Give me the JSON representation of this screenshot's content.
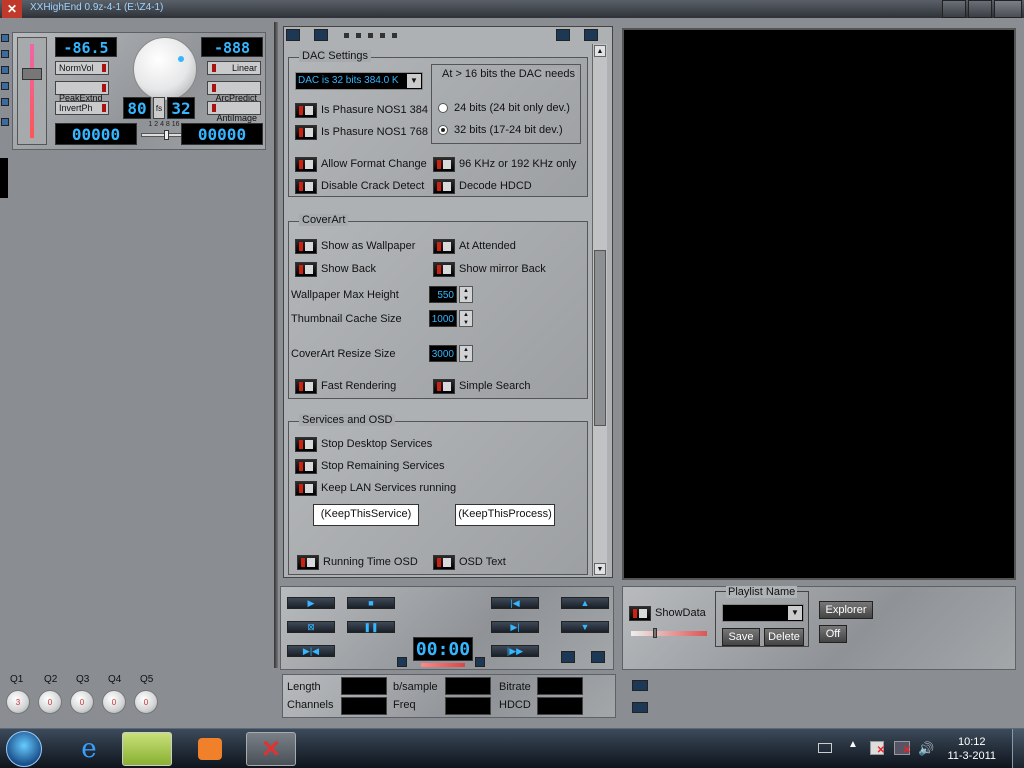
{
  "window": {
    "title": "XXHighEnd 0.9z-4-1 (E:\\Z4-1)"
  },
  "left_panel": {
    "lcd_top_left": "-86.5",
    "lcd_top_right": "-888",
    "toggles_left": [
      "NormVol",
      "PeakExtnd",
      "InvertPh"
    ],
    "toggles_right": [
      "Linear",
      "ArcPredict",
      "AntiImage"
    ],
    "lcd_mid_left": "80",
    "lcd_mid_fs": "fs",
    "lcd_mid_right": "32",
    "lcd_bottom_left": "00000",
    "lcd_bottom_right": "00000",
    "slider_ticks": "1 2 4 8 16"
  },
  "dac": {
    "label": "DAC Settings",
    "select_value": "DAC is 32 bits 384.0 K",
    "needs_label": "At > 16 bits the DAC needs",
    "radio_24": "24 bits (24 bit only dev.)",
    "radio_32": "32 bits (17-24 bit dev.)",
    "selected_radio": "32",
    "chk_nos384": "Is Phasure NOS1 384",
    "chk_nos768": "Is Phasure NOS1 768",
    "chk_allow_format": "Allow Format Change",
    "chk_96k": "96 KHz or 192 KHz only",
    "chk_disable_crack": "Disable Crack Detect",
    "chk_decode_hdcd": "Decode HDCD"
  },
  "coverart": {
    "label": "CoverArt",
    "chk_show_wallpaper": "Show as Wallpaper",
    "chk_at_attended": "At Attended",
    "chk_show_back": "Show Back",
    "chk_show_mirror_back": "Show mirror Back",
    "wallpaper_max_height_label": "Wallpaper Max Height",
    "wallpaper_max_height": "550",
    "thumbnail_cache_label": "Thumbnail Cache Size",
    "thumbnail_cache": "1000",
    "resize_label": "CoverArt Resize Size",
    "resize": "3000",
    "chk_fast_rendering": "Fast Rendering",
    "chk_simple_search": "Simple Search"
  },
  "services": {
    "label": "Services and OSD",
    "chk_stop_desktop": "Stop Desktop Services",
    "chk_stop_remaining": "Stop Remaining Services",
    "chk_keep_lan": "Keep LAN Services running",
    "btn_keep_service": "(KeepThisService)",
    "btn_keep_process": "(KeepThisProcess)",
    "chk_running_time": "Running Time OSD",
    "chk_osd_text": "OSD Text"
  },
  "transport": {
    "time_display": "00:00"
  },
  "playlist": {
    "showdata_label": "ShowData",
    "playlist_name_label": "Playlist Name",
    "save": "Save",
    "delete": "Delete",
    "explorer": "Explorer",
    "off": "Off"
  },
  "info": {
    "length": "Length",
    "channels": "Channels",
    "bsample": "b/sample",
    "freq": "Freq",
    "bitrate": "Bitrate",
    "hdcd": "HDCD"
  },
  "q_knobs": [
    {
      "label": "Q1",
      "value": "3"
    },
    {
      "label": "Q2",
      "value": "0"
    },
    {
      "label": "Q3",
      "value": "0"
    },
    {
      "label": "Q4",
      "value": "0"
    },
    {
      "label": "Q5",
      "value": "0"
    }
  ],
  "taskbar": {
    "time": "10:12",
    "date": "11-3-2011"
  },
  "colors": {
    "lcd_text": "#35b6ff",
    "led_red": "#c21",
    "panel_grey": "#aeb1b4"
  }
}
